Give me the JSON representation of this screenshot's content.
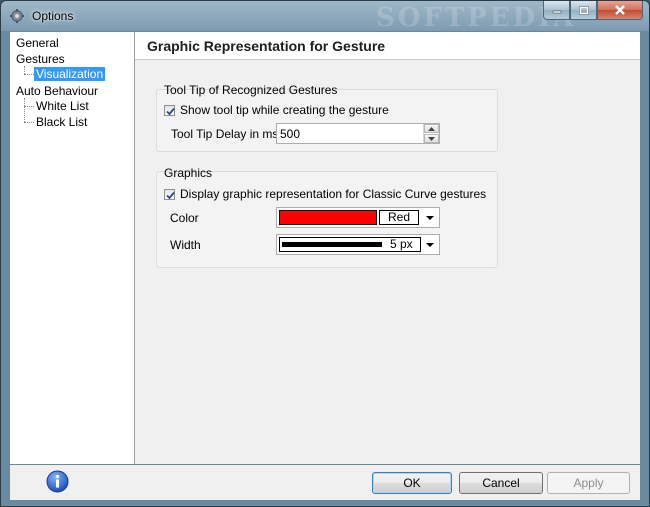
{
  "window": {
    "title": "Options",
    "watermark": "SOFTPEDIA"
  },
  "tree": {
    "items": [
      {
        "label": "General"
      },
      {
        "label": "Gestures"
      },
      {
        "label": "Visualization"
      },
      {
        "label": "Auto Behaviour"
      },
      {
        "label": "White List"
      },
      {
        "label": "Black List"
      }
    ]
  },
  "panel": {
    "title": "Graphic Representation for Gesture",
    "tooltip_group": {
      "label": "Tool Tip of Recognized Gestures",
      "show_tooltip": {
        "label": "Show tool tip while creating the gesture",
        "checked": true
      },
      "delay_label": "Tool Tip Delay in ms",
      "delay_value": "500"
    },
    "graphics_group": {
      "label": "Graphics",
      "display": {
        "label": "Display graphic representation for Classic Curve gestures",
        "checked": true
      },
      "color_label": "Color",
      "color_value": "Red",
      "color_swatch": "#ff0000",
      "width_label": "Width",
      "width_value": "5 px"
    }
  },
  "buttons": {
    "ok": "OK",
    "cancel": "Cancel",
    "apply": "Apply"
  }
}
